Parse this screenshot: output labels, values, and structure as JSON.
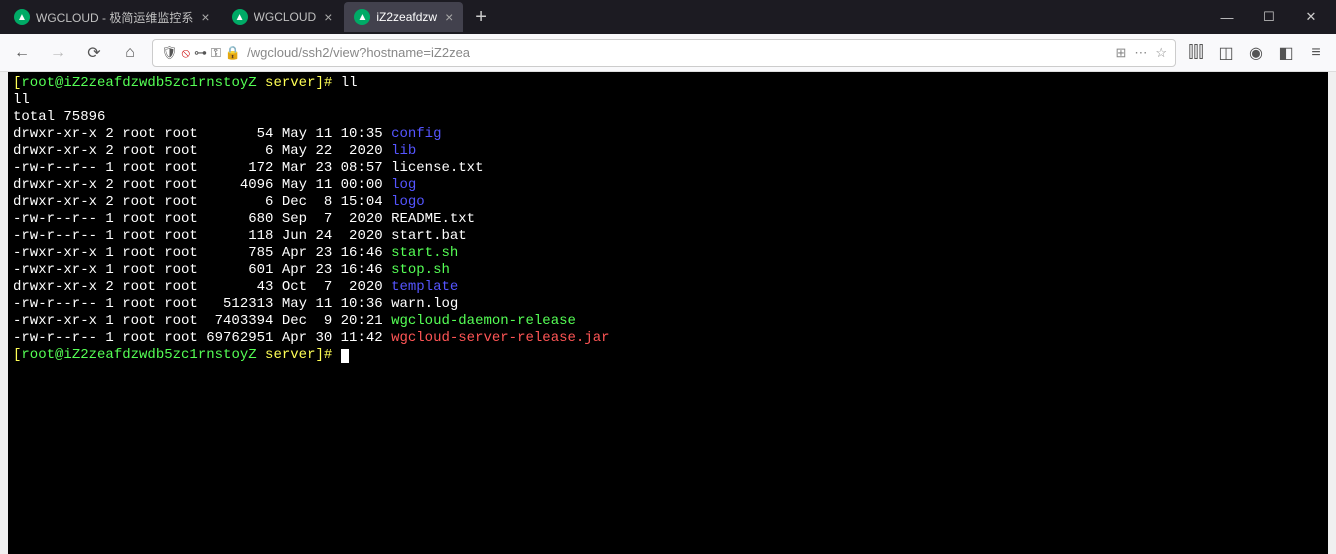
{
  "tabs": [
    {
      "title": "WGCLOUD - 极简运维监控系"
    },
    {
      "title": "WGCLOUD"
    },
    {
      "title": "iZ2zeafdzw"
    }
  ],
  "url": {
    "domain": "",
    "path": "/wgcloud/ssh2/view?hostname=iZ2zea"
  },
  "term": {
    "prefix_open": "[",
    "user_host": "root@iZ2zeafdzwdb5zc1rnstoyZ",
    "cwd": " server",
    "prefix_close": "]# ",
    "cmd": "ll",
    "echo": "ll",
    "total": "total 75896",
    "rows": [
      {
        "perm": "drwxr-xr-x 2 root root       54 May 11 10:35 ",
        "name": "config",
        "cls": "blue"
      },
      {
        "perm": "drwxr-xr-x 2 root root        6 May 22  2020 ",
        "name": "lib",
        "cls": "blue"
      },
      {
        "perm": "-rw-r--r-- 1 root root      172 Mar 23 08:57 ",
        "name": "license.txt",
        "cls": ""
      },
      {
        "perm": "drwxr-xr-x 2 root root     4096 May 11 00:00 ",
        "name": "log",
        "cls": "blue"
      },
      {
        "perm": "drwxr-xr-x 2 root root        6 Dec  8 15:04 ",
        "name": "logo",
        "cls": "blue"
      },
      {
        "perm": "-rw-r--r-- 1 root root      680 Sep  7  2020 ",
        "name": "README.txt",
        "cls": ""
      },
      {
        "perm": "-rw-r--r-- 1 root root      118 Jun 24  2020 ",
        "name": "start.bat",
        "cls": ""
      },
      {
        "perm": "-rwxr-xr-x 1 root root      785 Apr 23 16:46 ",
        "name": "start.sh",
        "cls": "green"
      },
      {
        "perm": "-rwxr-xr-x 1 root root      601 Apr 23 16:46 ",
        "name": "stop.sh",
        "cls": "green"
      },
      {
        "perm": "drwxr-xr-x 2 root root       43 Oct  7  2020 ",
        "name": "template",
        "cls": "blue"
      },
      {
        "perm": "-rw-r--r-- 1 root root   512313 May 11 10:36 ",
        "name": "warn.log",
        "cls": ""
      },
      {
        "perm": "-rwxr-xr-x 1 root root  7403394 Dec  9 20:21 ",
        "name": "wgcloud-daemon-release",
        "cls": "green"
      },
      {
        "perm": "-rw-r--r-- 1 root root 69762951 Apr 30 11:42 ",
        "name": "wgcloud-server-release.jar",
        "cls": "red"
      }
    ]
  }
}
